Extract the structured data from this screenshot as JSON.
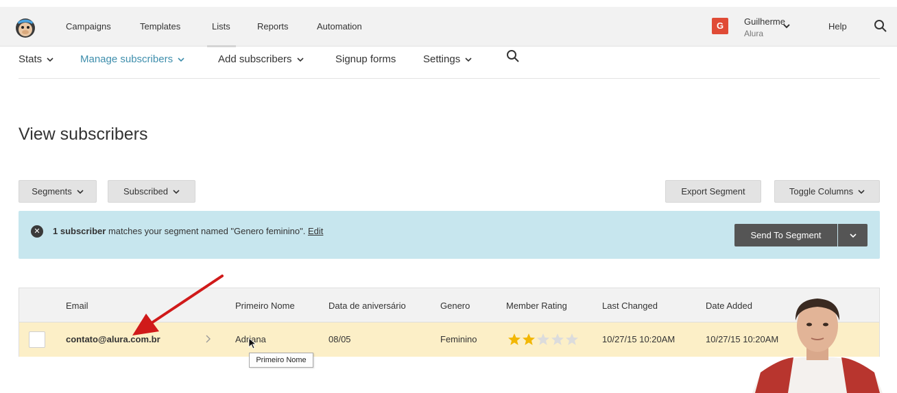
{
  "topnav": {
    "logo_icon": "mailchimp-monkey-icon",
    "items": [
      "Campaigns",
      "Templates",
      "Lists",
      "Reports",
      "Automation"
    ],
    "active": "Lists",
    "user": {
      "initial": "G",
      "name": "Guilherme",
      "org": "Alura"
    },
    "help": "Help",
    "search_icon": "search-icon"
  },
  "subnav": {
    "items": [
      "Stats",
      "Manage subscribers",
      "Add subscribers",
      "Signup forms",
      "Settings"
    ],
    "active": "Manage subscribers",
    "search_icon": "search-icon"
  },
  "page": {
    "title": "View subscribers"
  },
  "toolbar": {
    "segments": "Segments",
    "subscribed": "Subscribed",
    "export": "Export Segment",
    "toggle_columns": "Toggle Columns"
  },
  "banner": {
    "count_text": "1 subscriber",
    "message": " matches your segment named \"Genero feminino\". ",
    "edit": "Edit",
    "send": "Send To Segment"
  },
  "table": {
    "headers": [
      "Email",
      "Primeiro Nome",
      "Data de aniversário",
      "Genero",
      "Member Rating",
      "Last Changed",
      "Date Added"
    ],
    "rows": [
      {
        "email": "contato@alura.com.br",
        "primeiro_nome": "Adriana",
        "aniversario": "08/05",
        "genero": "Feminino",
        "rating": 2,
        "rating_max": 5,
        "last_changed": "10/27/15 10:20AM",
        "date_added": "10/27/15 10:20AM"
      }
    ]
  },
  "tooltip": "Primeiro Nome",
  "colors": {
    "accent": "#3e8eac",
    "banner_bg": "#c7e6ee",
    "row_highlight": "#fcefc7",
    "badge": "#e04b36",
    "star_filled": "#f2b705",
    "star_empty": "#dcdcdc",
    "annotation_arrow": "#d01a1a"
  }
}
